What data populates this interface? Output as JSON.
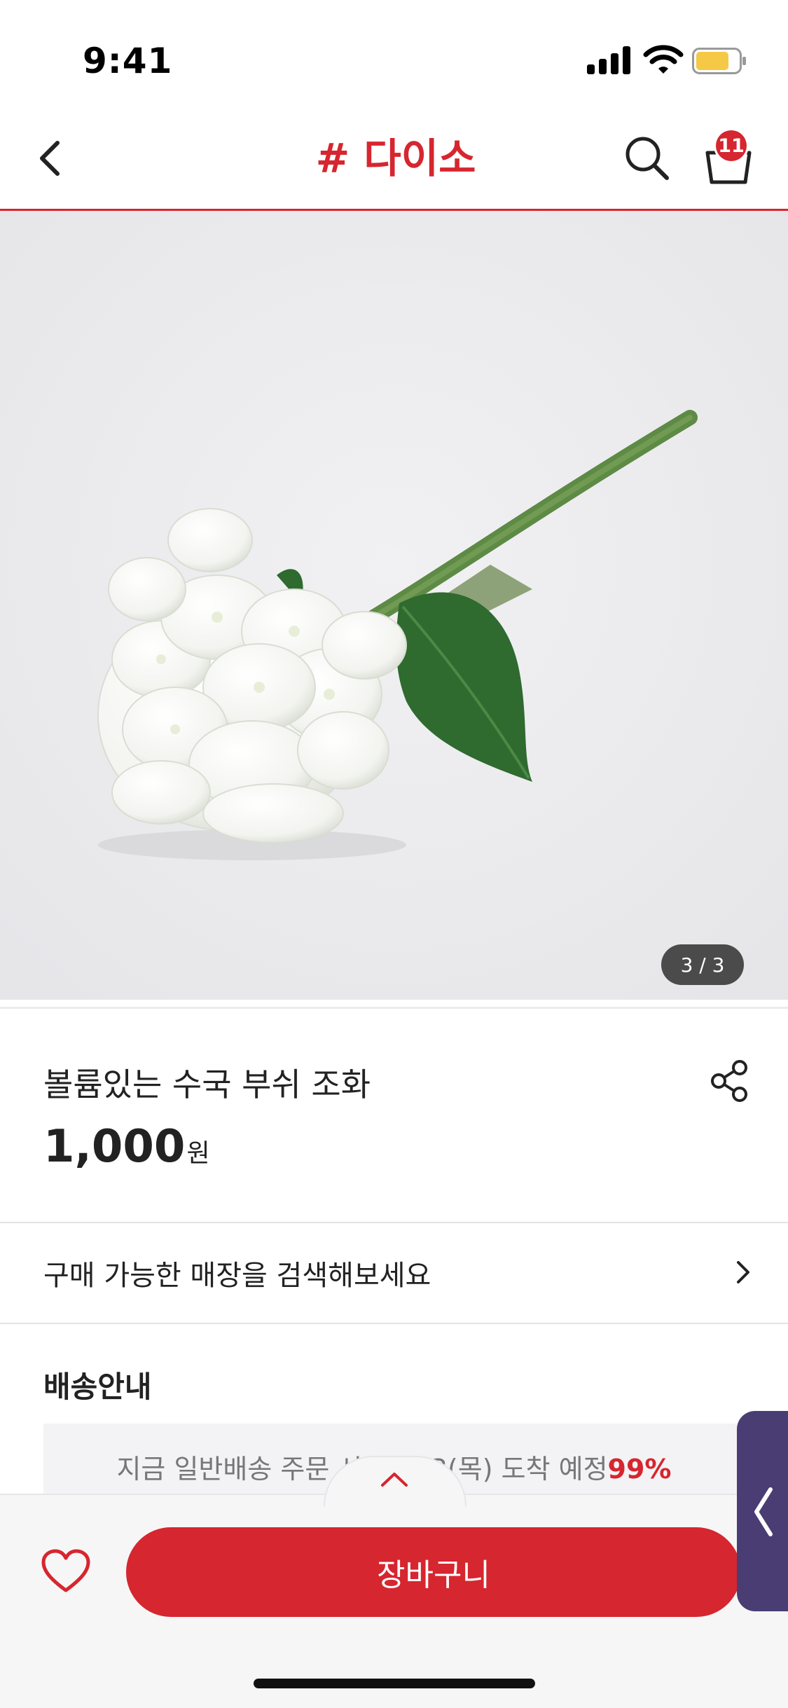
{
  "status_bar": {
    "time": "9:41"
  },
  "header": {
    "logo": "# 다이소",
    "cart_count": "11"
  },
  "gallery": {
    "counter": "3 / 3"
  },
  "product": {
    "name": "볼륨있는 수국 부쉬 조화",
    "price": "1,000",
    "price_unit": "원"
  },
  "store_search": {
    "label": "구매 가능한 매장을 검색해보세요"
  },
  "delivery": {
    "title": "배송안내",
    "text": "지금 일반배송 주문 시 01/13(목) 도착 예정",
    "percent": "99%"
  },
  "bottom_bar": {
    "cart_button": "장바구니"
  },
  "colors": {
    "brand": "#d6262f",
    "side_tab": "#4a3d74"
  }
}
